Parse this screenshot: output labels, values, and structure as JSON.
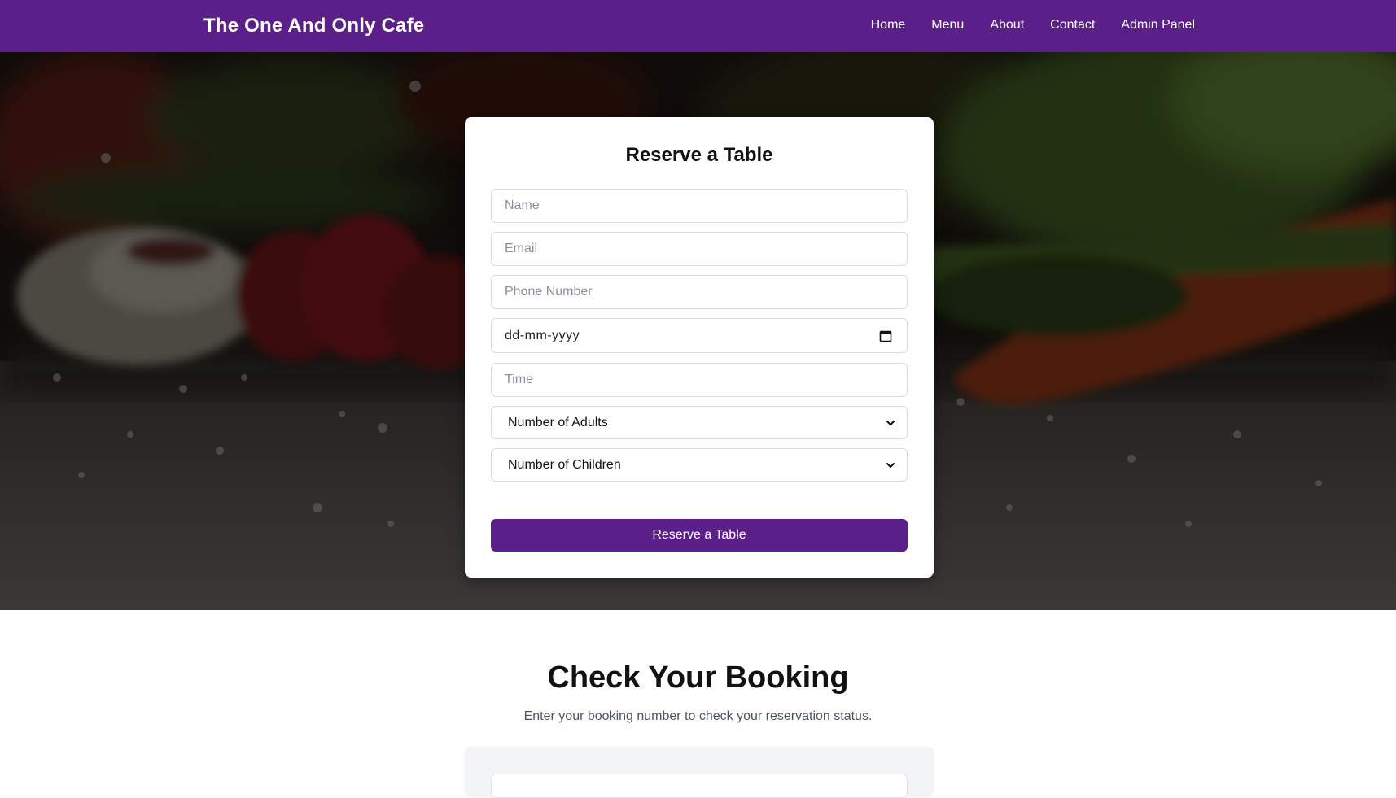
{
  "nav": {
    "brand": "The One And Only Cafe",
    "links": [
      "Home",
      "Menu",
      "About",
      "Contact",
      "Admin Panel"
    ]
  },
  "reserve": {
    "title": "Reserve a Table",
    "name_placeholder": "Name",
    "email_placeholder": "Email",
    "phone_placeholder": "Phone Number",
    "date_value": "dd-mm-yyyy",
    "time_placeholder": "Time",
    "adults_label": "Number of Adults",
    "children_label": "Number of Children",
    "submit_label": "Reserve a Table"
  },
  "booking": {
    "title": "Check Your Booking",
    "subtitle": "Enter your booking number to check your reservation status."
  },
  "colors": {
    "brand": "#5b1f8a",
    "card_bg": "#ffffff",
    "booking_card_bg": "#f3f4f6"
  },
  "icons": {
    "date": "calendar-icon",
    "select": "chevron-down-icon"
  }
}
